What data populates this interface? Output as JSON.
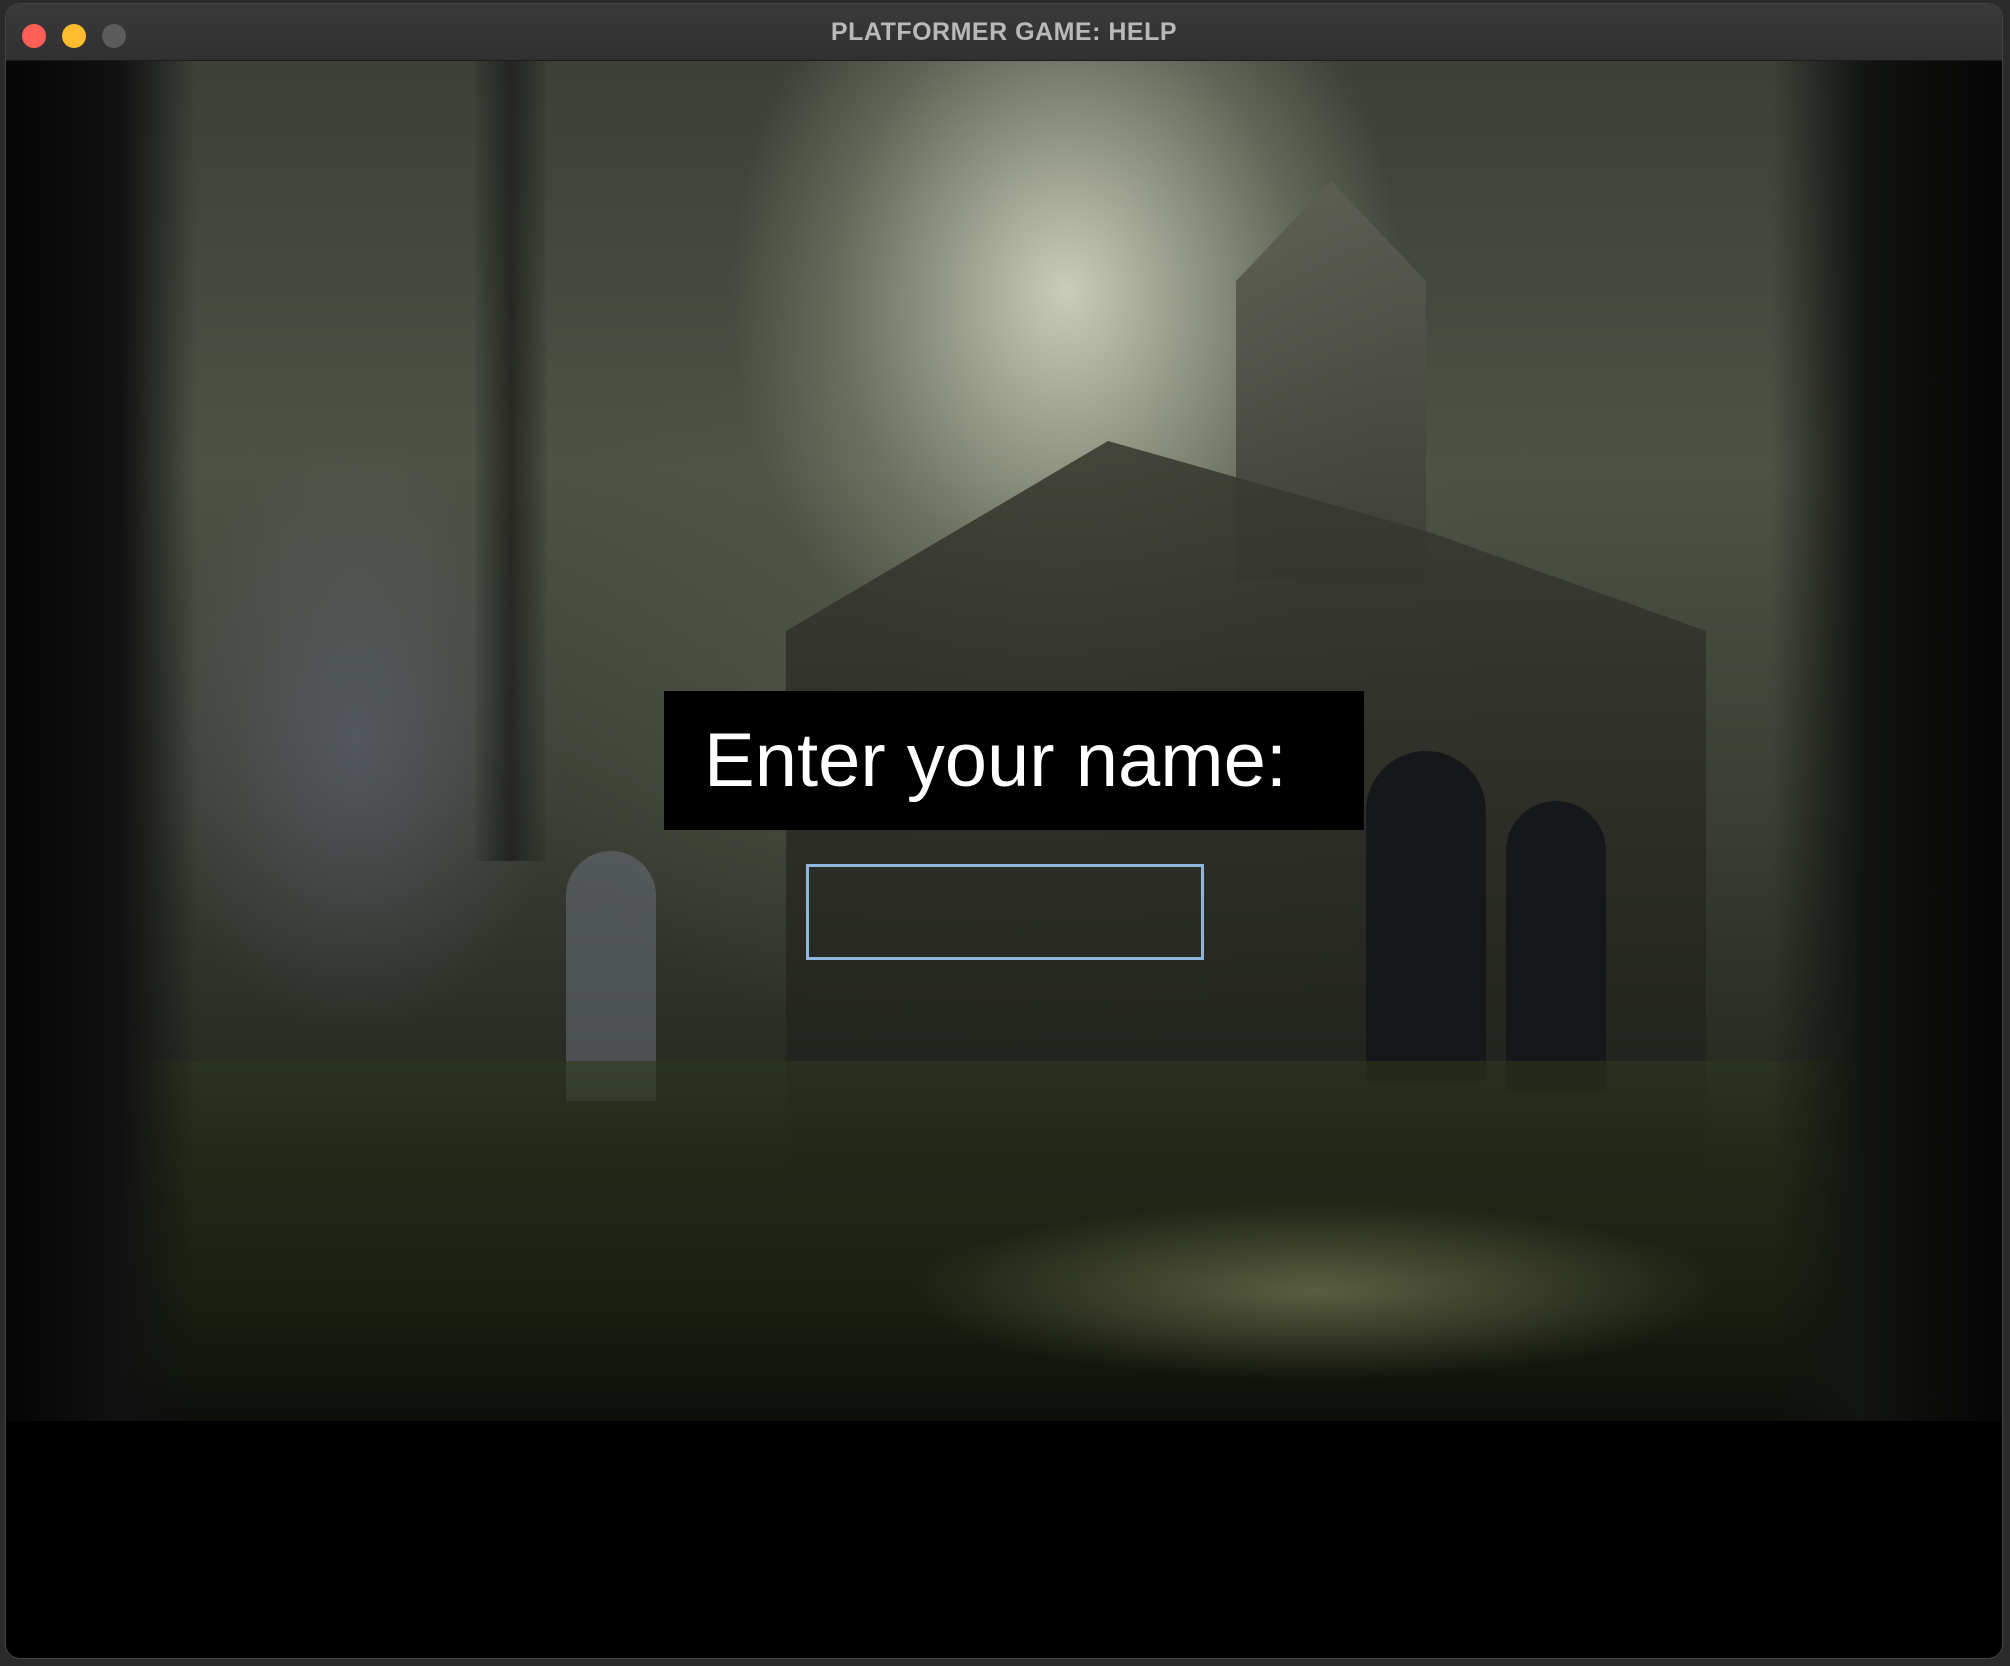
{
  "window": {
    "title": "PLATFORMER GAME: HELP"
  },
  "prompt": {
    "label": "Enter your name:",
    "input_value": ""
  },
  "colors": {
    "close": "#ff5f57",
    "minimize": "#febc2e",
    "zoom": "#5b5b5b",
    "input_border": "#8fb6de",
    "prompt_bg": "#000000",
    "prompt_text": "#ffffff"
  },
  "scene": {
    "background": "ruined overgrown chapel in misty forest"
  }
}
